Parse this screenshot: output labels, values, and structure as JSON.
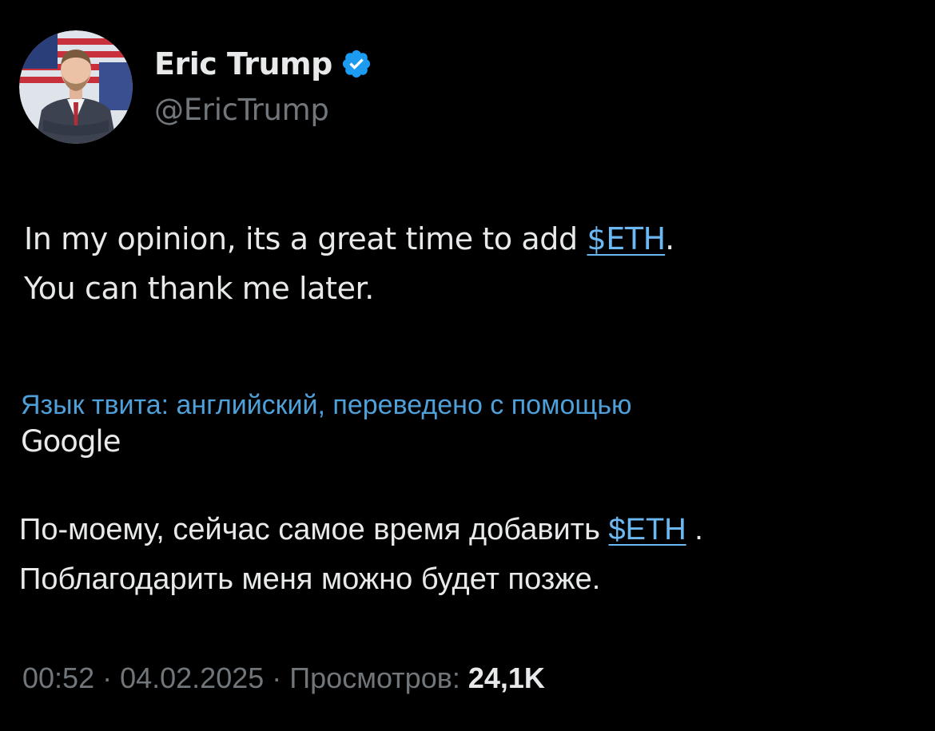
{
  "author": {
    "display_name": "Eric Trump",
    "handle": "@EricTrump",
    "verified_icon": "verified-badge-icon",
    "verified_color": "#1d9bf0"
  },
  "tweet": {
    "text_before": "In my opinion, its a great time to add ",
    "cashtag": "$ETH",
    "text_after_cashtag": ".",
    "text_line2": "You can thank me later."
  },
  "translation": {
    "note": "Язык твита: английский, переведено с помощью",
    "provider": "Google",
    "text_before": "По-моему, сейчас самое время добавить ",
    "cashtag": "$ETH",
    "text_after_cashtag": " .",
    "text_line2": "Поблагодарить меня можно будет позже."
  },
  "meta": {
    "time": "00:52",
    "separator": " · ",
    "date": "04.02.2025",
    "views_label": "Просмотров: ",
    "views_count": "24,1K"
  },
  "colors": {
    "background": "#000000",
    "text_primary": "#e7e9ea",
    "text_secondary": "#71767b",
    "link": "#6cb8f3",
    "translation_note": "#4f9fd9"
  }
}
